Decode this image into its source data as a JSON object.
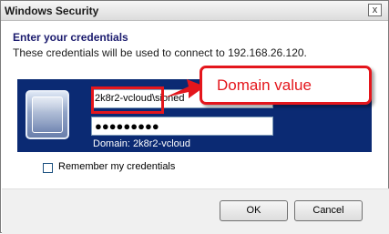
{
  "window": {
    "title": "Windows Security",
    "close_label": "x"
  },
  "dialog": {
    "heading": "Enter your credentials",
    "subheading": "These credentials will be used to connect to 192.168.26.120."
  },
  "credentials": {
    "username_value": "2k8r2-vcloud\\sioned",
    "password_mask": "●●●●●●●●●",
    "domain_text": "Domain: 2k8r2-vcloud"
  },
  "annotation": {
    "callout_text": "Domain value",
    "color": "#e4161c"
  },
  "remember": {
    "label": "Remember my credentials",
    "checked": false
  },
  "buttons": {
    "ok_label": "OK",
    "cancel_label": "Cancel"
  }
}
